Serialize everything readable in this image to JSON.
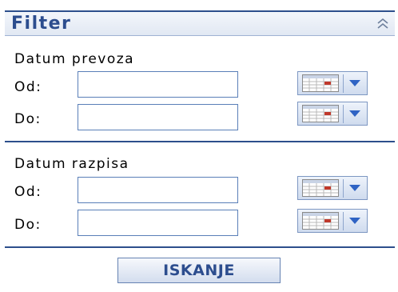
{
  "filter": {
    "title": "Filter",
    "collapse_icon": "double-chevron-up-icon",
    "sections": [
      {
        "title": "Datum prevoza",
        "from_label": "Od:",
        "from_value": "",
        "to_label": "Do:",
        "to_value": ""
      },
      {
        "title": "Datum razpisa",
        "from_label": "Od:",
        "from_value": "",
        "to_label": "Do:",
        "to_value": ""
      }
    ],
    "calendar_icon": "calendar-icon",
    "dropdown_icon": "dropdown-arrow-icon",
    "search_label": "ISKANJE"
  },
  "colors": {
    "accent": "#2c4d8e",
    "border": "#5a7fb8",
    "dropdown_arrow": "#2f63c4",
    "calendar_red": "#c0392b"
  }
}
